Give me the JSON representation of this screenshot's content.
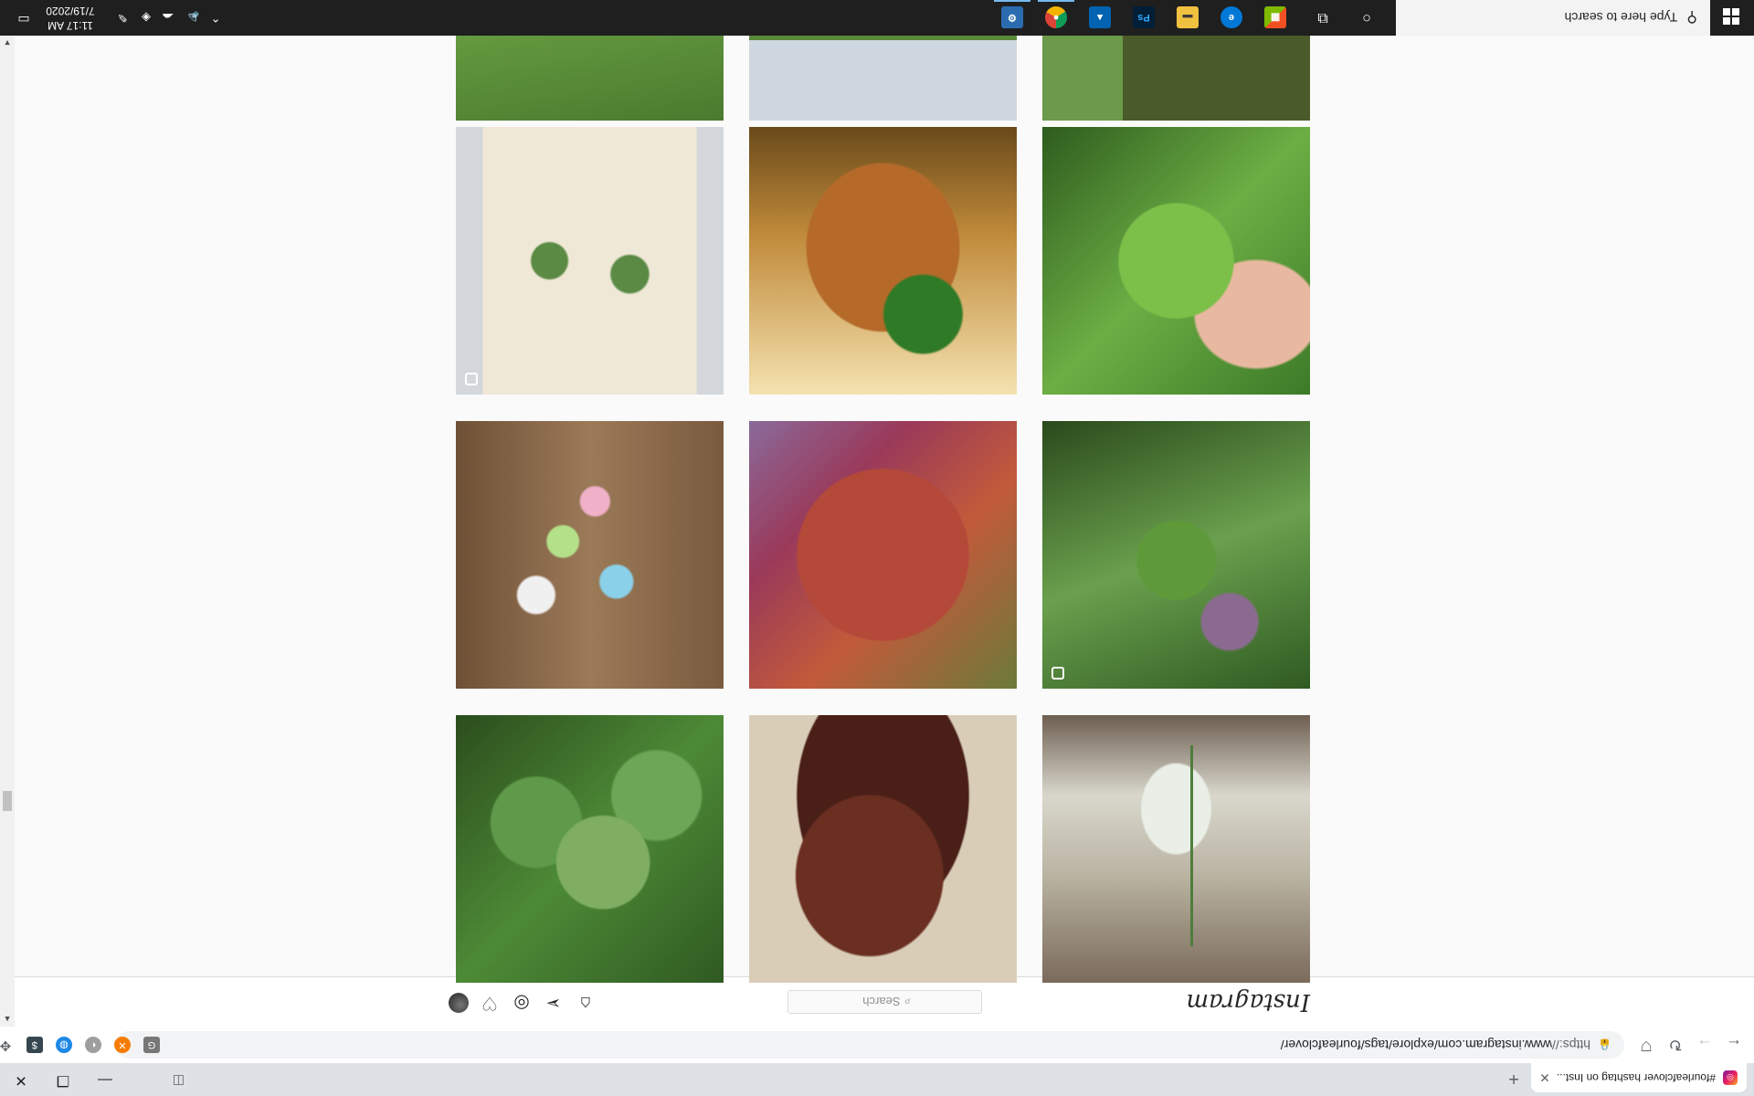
{
  "browser": {
    "tab_title": "#fourleafclover hashtag on Inst...",
    "favicon": "instagram-icon",
    "url_scheme": "https://",
    "url_rest": "www.instagram.com/explore/tags/fourleafclover/",
    "profile_initial": "Z"
  },
  "instagram": {
    "logo": "Instagram",
    "search_placeholder": "Search",
    "nav_icons": [
      "home-icon",
      "direct-icon",
      "explore-icon",
      "activity-icon",
      "profile-avatar"
    ]
  },
  "grid": {
    "rows": [
      [
        "meadow-grass",
        "bird-on-grass",
        "insect-collage"
      ],
      [
        "pressed-clover-book",
        "hand-with-ring-clover",
        "hand-holding-clover"
      ],
      [
        "clover-rings-on-wood",
        "clover-on-painted-rock",
        "clover-in-grass"
      ],
      [
        "clover-leaves",
        "long-brown-hair",
        "clover-in-bottle"
      ]
    ],
    "multi_photo_tiles": [
      "pressed-clover-book",
      "clover-in-grass"
    ]
  },
  "taskbar": {
    "search_placeholder": "Type here to search",
    "time": "11:17 AM",
    "date": "7/19/2020",
    "apps": [
      "cortana",
      "task-view",
      "microsoft-store",
      "edge",
      "file-explorer",
      "photoshop",
      "photos",
      "chrome",
      "settings"
    ]
  },
  "colors": {
    "chrome_tab_strip": "#dee1e6",
    "instagram_background": "#fafafa",
    "taskbar": "#1f1f1f"
  }
}
